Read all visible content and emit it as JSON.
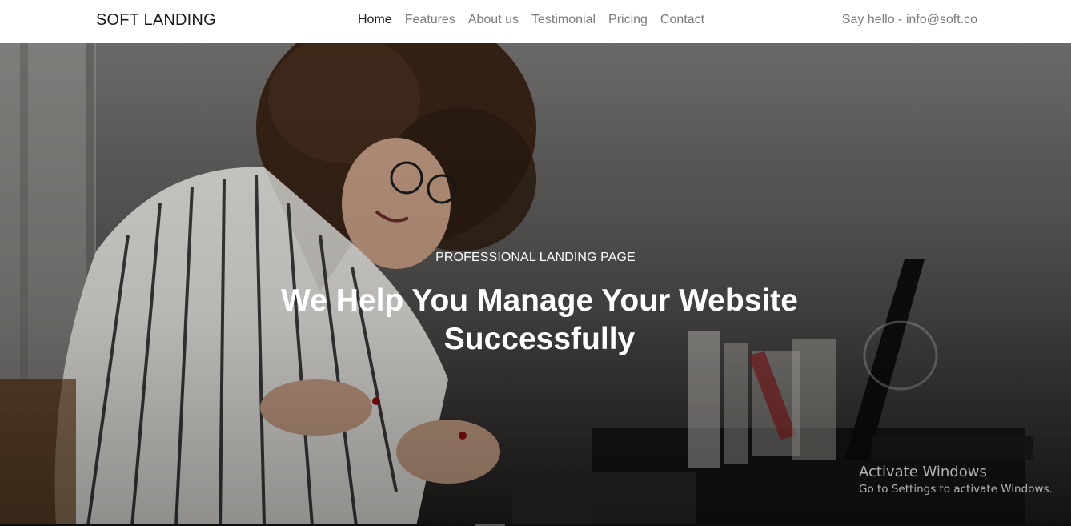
{
  "navbar": {
    "brand": "SOFT LANDING",
    "links": [
      "Home",
      "Features",
      "About us",
      "Testimonial",
      "Pricing",
      "Contact"
    ],
    "active_link": "Home",
    "contact": "Say hello - info@soft.co"
  },
  "hero": {
    "eyebrow": "PROFESSIONAL LANDING PAGE",
    "title": "We Help You Manage Your Website Successfully"
  },
  "watermark": {
    "title": "Activate Windows",
    "subtitle": "Go to Settings to activate Windows."
  },
  "colors": {
    "navbar_bg": "#ffffff",
    "nav_text": "#7a7a7a",
    "nav_active": "#222222",
    "hero_text": "#ffffff"
  }
}
